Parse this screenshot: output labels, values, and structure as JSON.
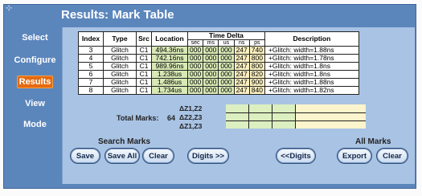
{
  "window": {
    "title": "Results: Mark Table"
  },
  "sidebar": {
    "items": [
      {
        "label": "Select"
      },
      {
        "label": "Configure"
      },
      {
        "label": "Results"
      },
      {
        "label": "View"
      },
      {
        "label": "Mode"
      }
    ]
  },
  "table": {
    "headers": {
      "index": "Index",
      "type": "Type",
      "src": "Src",
      "location": "Location",
      "time_delta": "Time Delta",
      "description": "Description"
    },
    "subheaders": [
      "sec",
      "ms",
      "us",
      "ns",
      "ps"
    ],
    "rows": [
      {
        "index": "3",
        "type": "Glitch",
        "src": "C1",
        "location": "494.36ns",
        "sec": "000",
        "ms": "000",
        "us": "000",
        "ns": "247",
        "ps": "740",
        "description": "+Glitch: width=1.88ns"
      },
      {
        "index": "4",
        "type": "Glitch",
        "src": "C1",
        "location": "742.16ns",
        "sec": "000",
        "ms": "000",
        "us": "000",
        "ns": "247",
        "ps": "800",
        "description": "+Glitch: width=1.78ns"
      },
      {
        "index": "5",
        "type": "Glitch",
        "src": "C1",
        "location": "989.96ns",
        "sec": "000",
        "ms": "000",
        "us": "000",
        "ns": "247",
        "ps": "800",
        "description": "+Glitch: width=1.8ns"
      },
      {
        "index": "6",
        "type": "Glitch",
        "src": "C1",
        "location": "1.238us",
        "sec": "000",
        "ms": "000",
        "us": "000",
        "ns": "247",
        "ps": "820",
        "description": "+Glitch: width=1.8ns"
      },
      {
        "index": "7",
        "type": "Glitch",
        "src": "C1",
        "location": "1.486us",
        "sec": "000",
        "ms": "000",
        "us": "000",
        "ns": "247",
        "ps": "900",
        "description": "+Glitch: width=1.88ns"
      },
      {
        "index": "8",
        "type": "Glitch",
        "src": "C1",
        "location": "1.734us",
        "sec": "000",
        "ms": "000",
        "us": "000",
        "ns": "247",
        "ps": "840",
        "description": "+Glitch: width=1.82ns"
      }
    ]
  },
  "totals": {
    "label": "Total Marks:",
    "count": "64",
    "deltas": [
      "ΔZ1,Z2",
      "ΔZ2,Z3",
      "ΔZ1,Z3"
    ]
  },
  "search_marks": {
    "title": "Search Marks",
    "save": "Save",
    "save_all": "Save All",
    "clear": "Clear",
    "digits_more": "Digits >>",
    "digits_less": "<<Digits"
  },
  "all_marks": {
    "title": "All Marks",
    "export": "Export",
    "clear": "Clear"
  },
  "colors": {
    "frame": "#5b86bc",
    "panel": "#a9c3e4",
    "active": "#e66a10",
    "cell_green": "#d8e9b5",
    "cell_yellow": "#fbf0c0"
  }
}
